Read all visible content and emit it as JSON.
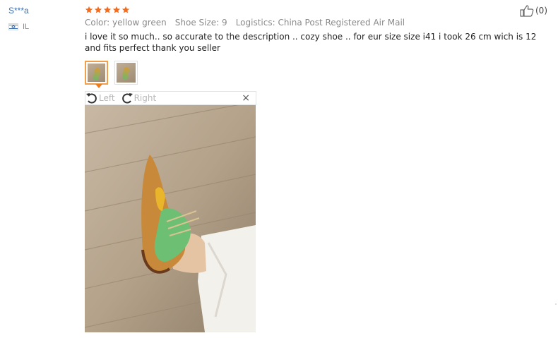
{
  "reviewer": {
    "name": "S***a",
    "country_code": "IL",
    "flag_icon": "israel-flag-icon"
  },
  "review": {
    "rating": 5,
    "star_color": "#f26c1f",
    "color_label": "Color:",
    "color_value": "yellow green",
    "size_label": "Shoe Size:",
    "size_value": "9",
    "logistics_label": "Logistics:",
    "logistics_value": "China Post Registered Air Mail",
    "text": "i love it so much.. so accurate to the description .. cozy shoe .. for eur size size i41 i took 26 cm wich is 12 and fits perfect thank you seller"
  },
  "helpful": {
    "icon": "thumbs-up-icon",
    "count": "(0)"
  },
  "thumbnails": [
    {
      "selected": true
    },
    {
      "selected": false
    }
  ],
  "viewer": {
    "rotate_left": "Left",
    "rotate_right": "Right",
    "close": "×"
  }
}
